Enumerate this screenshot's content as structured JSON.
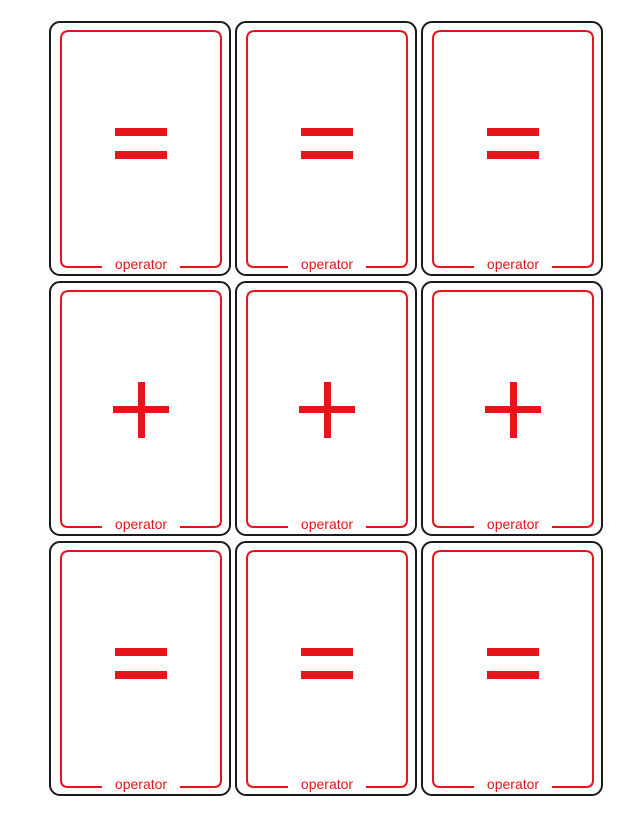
{
  "accent_color": "#e8141c",
  "cards": [
    {
      "symbol": "=",
      "symbol_name": "equals",
      "label": "operator"
    },
    {
      "symbol": "=",
      "symbol_name": "equals",
      "label": "operator"
    },
    {
      "symbol": "=",
      "symbol_name": "equals",
      "label": "operator"
    },
    {
      "symbol": "+",
      "symbol_name": "plus",
      "label": "operator"
    },
    {
      "symbol": "+",
      "symbol_name": "plus",
      "label": "operator"
    },
    {
      "symbol": "+",
      "symbol_name": "plus",
      "label": "operator"
    },
    {
      "symbol": "=",
      "symbol_name": "equals",
      "label": "operator"
    },
    {
      "symbol": "=",
      "symbol_name": "equals",
      "label": "operator"
    },
    {
      "symbol": "=",
      "symbol_name": "equals",
      "label": "operator"
    }
  ]
}
